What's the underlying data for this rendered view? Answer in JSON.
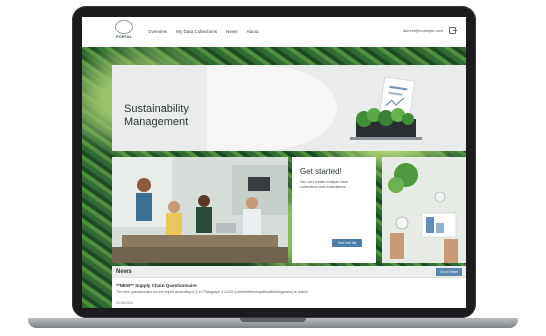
{
  "nav": {
    "logo_text": "PORTAL",
    "links": [
      "Overview",
      "My Data Collections",
      "News",
      "About"
    ],
    "user_email": "laurent@example.com",
    "logout_icon": "logout-icon"
  },
  "hero": {
    "title_line1": "Sustainability",
    "title_line2": "Management"
  },
  "get_started": {
    "title": "Get started!",
    "text": "You can create multiple data collections and evaluations.",
    "button": "Your Info list"
  },
  "news": {
    "title": "News",
    "button": "Go to News",
    "item_title": "**NEW** Supply Chain Questionnaire",
    "item_text": "The new questionnaire for the report according to § 10 Paragraph 2 LkSG (Lieferkettensorgfaltspflichtengesetz) is online!",
    "item_date": "19.06.2024"
  },
  "colors": {
    "accent_button": "#4a7dab",
    "nav_bg": "#ffffff",
    "forest": "#2f6b33"
  }
}
